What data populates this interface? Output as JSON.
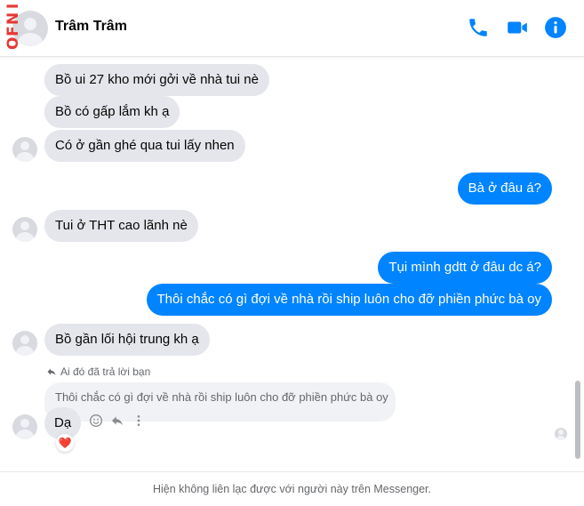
{
  "header": {
    "watermark": "INFO",
    "contact_name": "Trâm Trâm",
    "icons": [
      "phone-icon",
      "video-camera-icon",
      "info-icon"
    ],
    "accent_color": "#0084ff"
  },
  "messages": [
    {
      "sender": "them",
      "text": "Bồ ui 27 kho mới gởi về nhà tui nè"
    },
    {
      "sender": "them",
      "text": "Bồ có gấp lắm kh ạ"
    },
    {
      "sender": "them",
      "text": "Có ở gần ghé qua tui lấy nhen"
    },
    {
      "sender": "me",
      "text": "Bà ở đâu á?"
    },
    {
      "sender": "them",
      "text": "Tui ở THT cao lãnh nè"
    },
    {
      "sender": "me",
      "text": "Tụi mình gdtt ở đâu dc á?"
    },
    {
      "sender": "me",
      "text": "Thôi chắc có gì đợi về nhà rồi ship luôn cho đỡ phiền phức bà oy"
    },
    {
      "sender": "them",
      "text": "Bồ gần lối hội trung kh ạ"
    }
  ],
  "reply": {
    "label": "Ai đó đã trả lời bạn",
    "quoted_text": "Thôi chắc có gì đợi về nhà rồi ship luôn cho đỡ phiền phức bà oy",
    "text": "Dạ",
    "reaction": "❤️"
  },
  "footer": {
    "notice": "Hiện không liên lạc được với người này trên Messenger."
  }
}
